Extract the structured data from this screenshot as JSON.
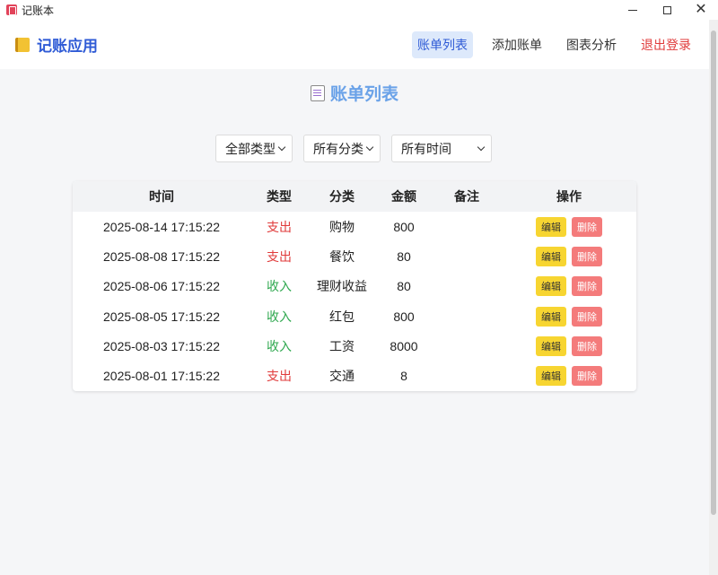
{
  "window": {
    "title": "记账本"
  },
  "header": {
    "brand": "记账应用",
    "nav": [
      {
        "label": "账单列表",
        "active": true
      },
      {
        "label": "添加账单",
        "active": false
      },
      {
        "label": "图表分析",
        "active": false
      },
      {
        "label": "退出登录",
        "active": false
      }
    ]
  },
  "main": {
    "title": "账单列表",
    "filters": [
      {
        "selected": "全部类型"
      },
      {
        "selected": "所有分类"
      },
      {
        "selected": "所有时间"
      }
    ],
    "table": {
      "columns": [
        "时间",
        "类型",
        "分类",
        "金额",
        "备注",
        "操作"
      ],
      "rows": [
        {
          "time": "2025-08-14 17:15:22",
          "type": "支出",
          "category": "购物",
          "amount": "800",
          "note": ""
        },
        {
          "time": "2025-08-08 17:15:22",
          "type": "支出",
          "category": "餐饮",
          "amount": "80",
          "note": ""
        },
        {
          "time": "2025-08-06 17:15:22",
          "type": "收入",
          "category": "理财收益",
          "amount": "80",
          "note": ""
        },
        {
          "time": "2025-08-05 17:15:22",
          "type": "收入",
          "category": "红包",
          "amount": "800",
          "note": ""
        },
        {
          "time": "2025-08-03 17:15:22",
          "type": "收入",
          "category": "工资",
          "amount": "8000",
          "note": ""
        },
        {
          "time": "2025-08-01 17:15:22",
          "type": "支出",
          "category": "交通",
          "amount": "8",
          "note": ""
        }
      ],
      "edit_label": "编辑",
      "delete_label": "删除"
    }
  },
  "colors": {
    "expense": "#e03b3b",
    "income": "#2fa84f",
    "brand": "#2f5bd6"
  },
  "icons": {
    "app": "ledger-icon",
    "brand": "notebook-icon",
    "title": "document-icon"
  }
}
